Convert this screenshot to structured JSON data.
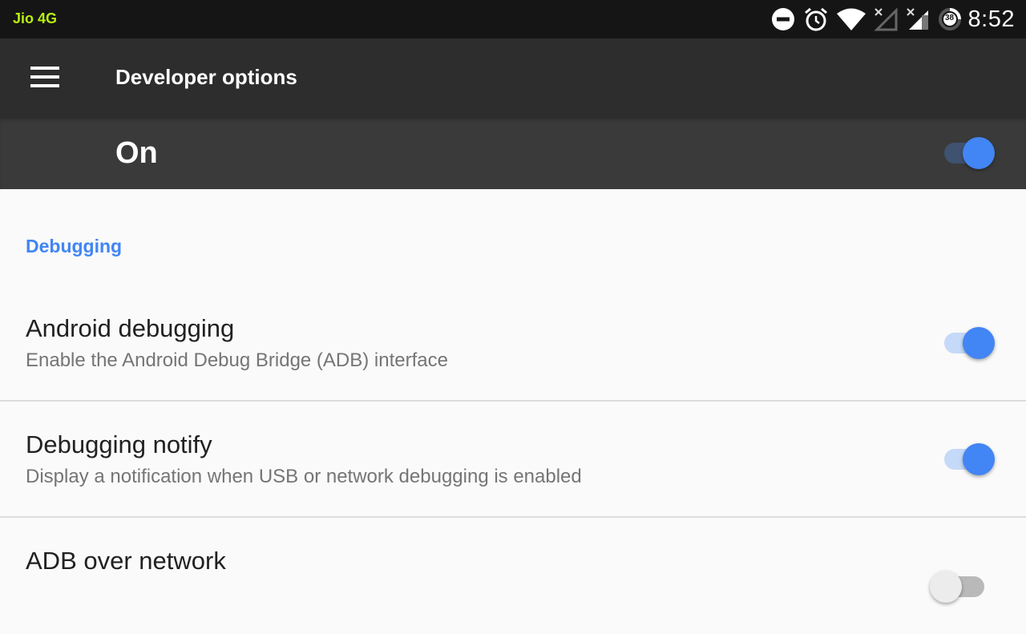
{
  "statusbar": {
    "carrier": "Jio 4G",
    "icons": [
      "do-not-disturb-icon",
      "alarm-icon",
      "wifi-icon",
      "signal-no-service-icon",
      "signal-icon",
      "battery-icon"
    ],
    "battery_level": "38",
    "time": "8:52",
    "carrier_color": "#b8ef12"
  },
  "toolbar": {
    "title": "Developer options",
    "menu_icon": "hamburger-menu-icon"
  },
  "master_switch": {
    "label": "On",
    "checked": true
  },
  "accent_color": "#4285f4",
  "category": {
    "title": "Debugging"
  },
  "preferences": [
    {
      "title": "Android debugging",
      "summary": "Enable the Android Debug Bridge (ADB) interface",
      "checked": true
    },
    {
      "title": "Debugging notify",
      "summary": "Display a notification when USB or network debugging is enabled",
      "checked": true
    },
    {
      "title": "ADB over network",
      "summary": "",
      "checked": false
    }
  ]
}
